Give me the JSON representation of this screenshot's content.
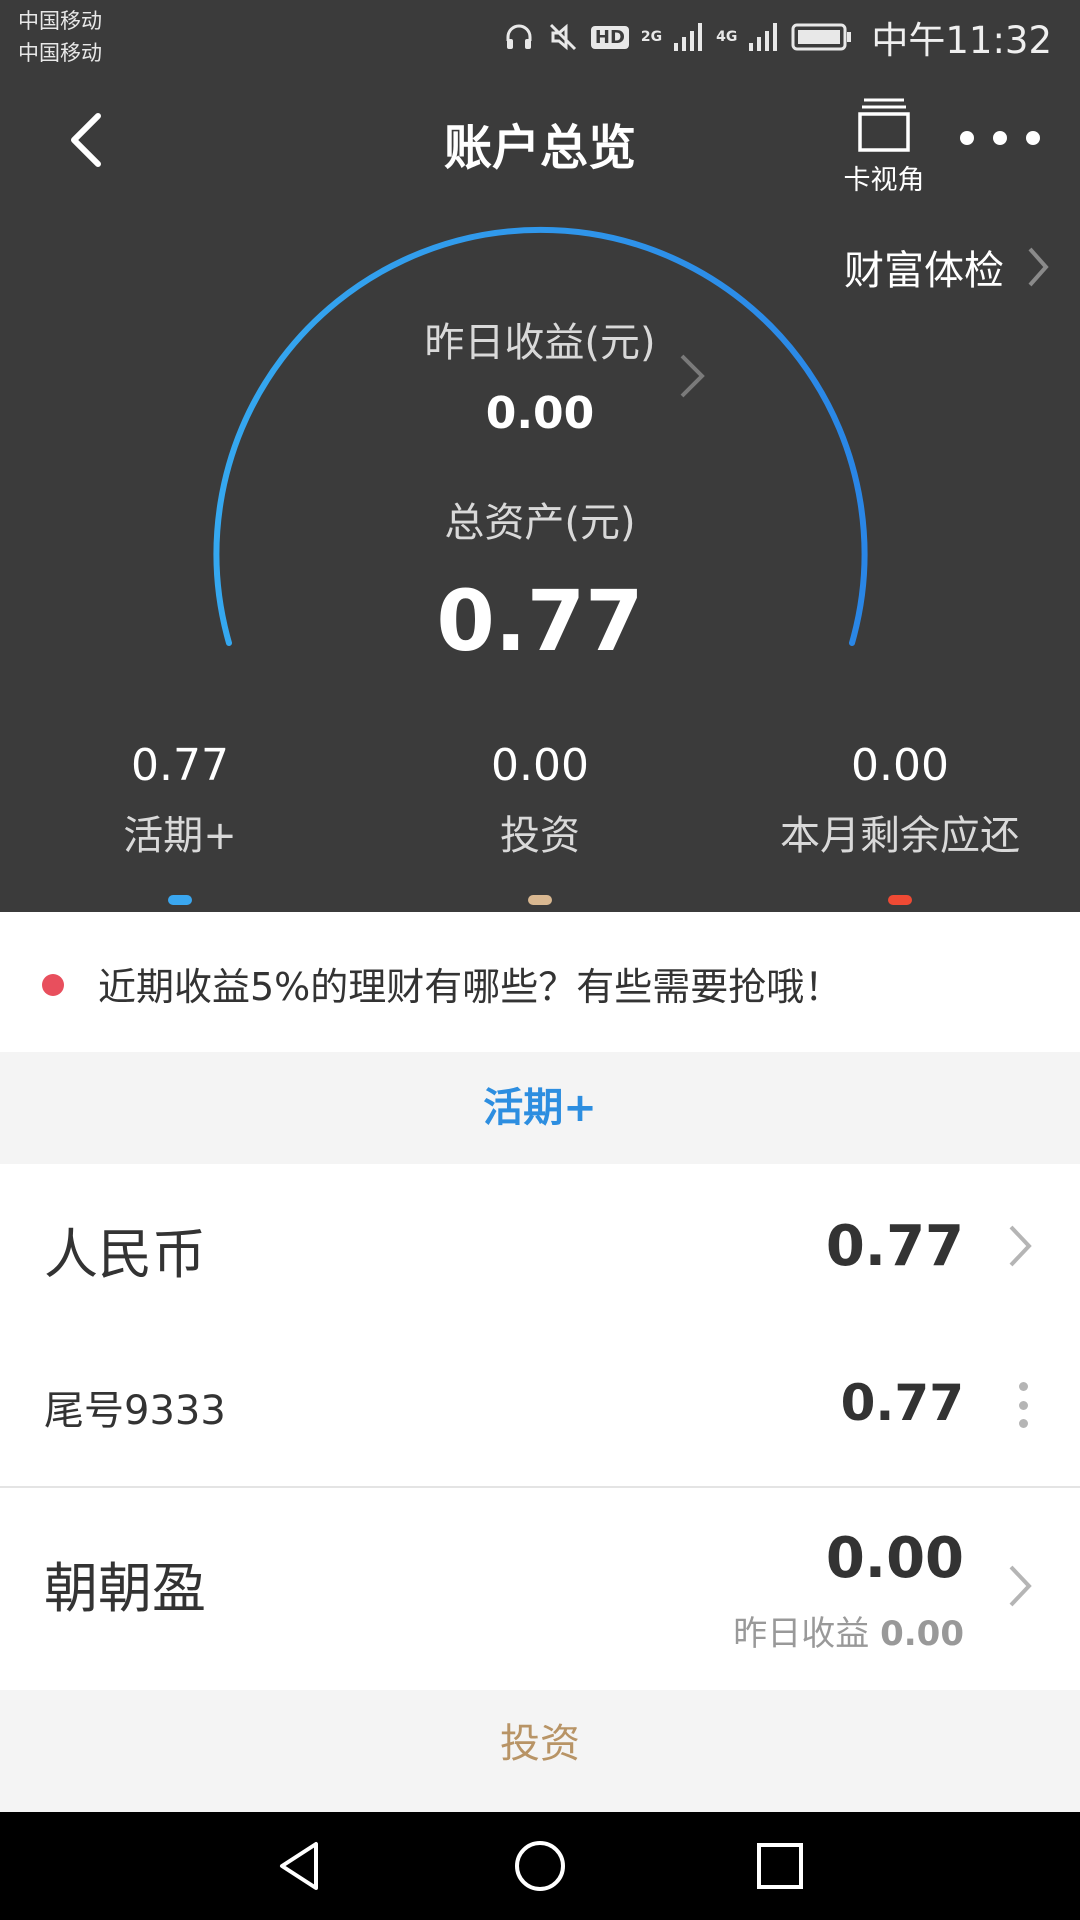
{
  "status_bar": {
    "carrier1": "中国移动",
    "carrier2": "中国移动",
    "hd": "HD",
    "net1": "2G",
    "net2": "4G",
    "time": "中午11:32"
  },
  "header": {
    "title": "账户总览",
    "card_view_label": "卡视角"
  },
  "wealth_check": {
    "label": "财富体检"
  },
  "gauge": {
    "yesterday_label": "昨日收益(元)",
    "yesterday_value": "0.00",
    "total_label": "总资产(元)",
    "total_value": "0.77",
    "arc_color": "#2b9ef0"
  },
  "stats": [
    {
      "value": "0.77",
      "label": "活期+",
      "color": "#3aa7f0"
    },
    {
      "value": "0.00",
      "label": "投资",
      "color": "#d9b891"
    },
    {
      "value": "0.00",
      "label": "本月剩余应还",
      "color": "#ef4a34"
    }
  ],
  "promo": {
    "text": "近期收益5%的理财有哪些？有些需要抢哦！"
  },
  "sections": {
    "current": "活期+",
    "invest": "投资"
  },
  "rows": {
    "rmb": {
      "label": "人民币",
      "value": "0.77"
    },
    "tail": {
      "label": "尾号9333",
      "value": "0.77"
    },
    "zhaozhaoying": {
      "label": "朝朝盈",
      "value": "0.00",
      "sub_label": "昨日收益",
      "sub_value": "0.00"
    }
  }
}
